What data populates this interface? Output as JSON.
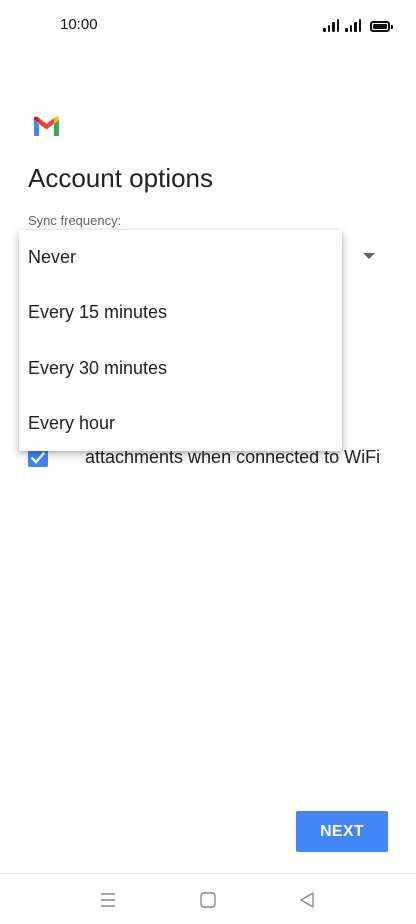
{
  "status_bar": {
    "time": "10:00"
  },
  "app": {
    "logo_icon": "gmail-icon",
    "brand_colors": [
      "#4285f4",
      "#ea4335",
      "#fbbc04",
      "#34a853"
    ]
  },
  "page": {
    "title": "Account options",
    "sync_label": "Sync frequency:"
  },
  "sync_menu": {
    "options": [
      "Never",
      "Every 15 minutes",
      "Every 30 minutes",
      "Every hour"
    ]
  },
  "checkbox": {
    "checked": true,
    "visible_text": "attachments when connected to WiFi"
  },
  "footer": {
    "next_label": "NEXT",
    "accent_color": "#4285f4"
  },
  "nav_bar": {
    "icons": [
      "menu-icon",
      "home-icon",
      "back-icon"
    ]
  }
}
